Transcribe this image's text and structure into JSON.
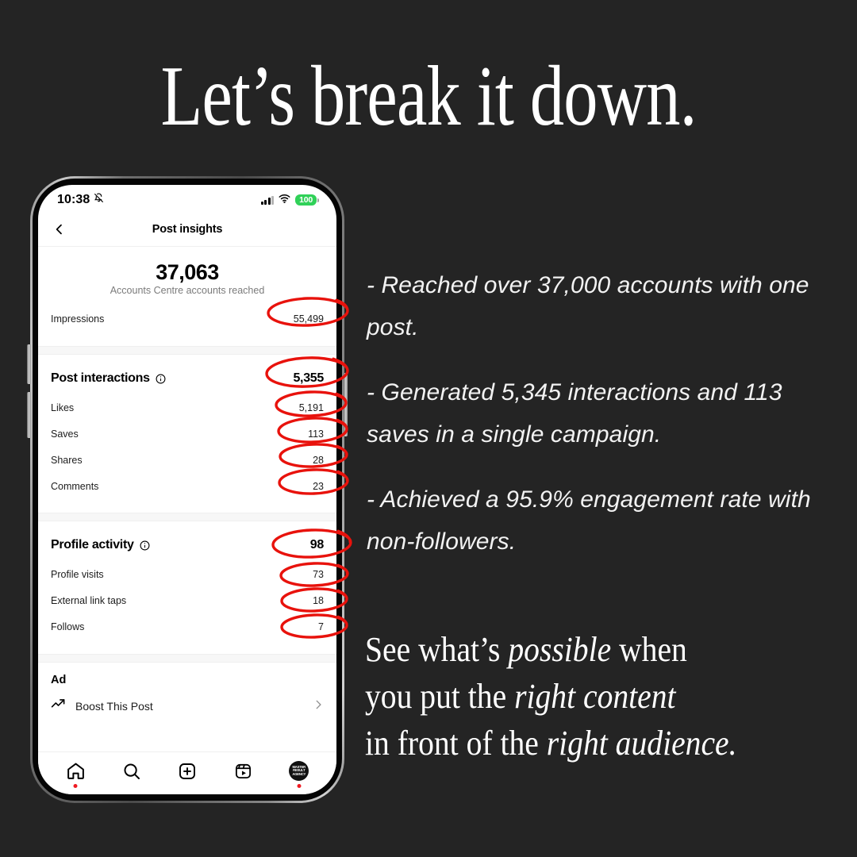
{
  "theme": {
    "background": "#242424",
    "text_primary": "#ffffff",
    "annotation_red": "#ef1b23",
    "battery_green": "#30d158"
  },
  "headline": "Let’s break it down.",
  "phone": {
    "status_bar": {
      "time": "10:38",
      "mute_icon": "bell-slash-icon",
      "signal_icon": "cellular-signal-icon",
      "wifi_icon": "wifi-icon",
      "battery_level": "100"
    },
    "nav": {
      "back_icon": "chevron-left-icon",
      "title": "Post insights"
    },
    "reach": {
      "value": "37,063",
      "label": "Accounts Centre accounts reached"
    },
    "impressions": {
      "label": "Impressions",
      "value": "55,499"
    },
    "post_interactions": {
      "title": "Post interactions",
      "info_icon": "info-circle-icon",
      "total": "5,355",
      "rows": [
        {
          "label": "Likes",
          "value": "5,191"
        },
        {
          "label": "Saves",
          "value": "113"
        },
        {
          "label": "Shares",
          "value": "28"
        },
        {
          "label": "Comments",
          "value": "23"
        }
      ]
    },
    "profile_activity": {
      "title": "Profile activity",
      "info_icon": "info-circle-icon",
      "total": "98",
      "rows": [
        {
          "label": "Profile visits",
          "value": "73"
        },
        {
          "label": "External link taps",
          "value": "18"
        },
        {
          "label": "Follows",
          "value": "7"
        }
      ]
    },
    "ad": {
      "title": "Ad",
      "boost_icon": "trending-up-arrow-icon",
      "boost_label": "Boost This Post",
      "chevron_icon": "chevron-right-icon"
    },
    "tabbar": [
      {
        "name": "home",
        "icon": "home-icon",
        "badge": true
      },
      {
        "name": "search",
        "icon": "search-icon",
        "badge": false
      },
      {
        "name": "create",
        "icon": "plus-square-icon",
        "badge": false
      },
      {
        "name": "reels",
        "icon": "reels-icon",
        "badge": false
      },
      {
        "name": "profile",
        "icon": "avatar-icon",
        "badge": true,
        "avatar_text": "MASTER RESULT AGENCY"
      }
    ]
  },
  "bullets": [
    "- Reached over 37,000 accounts with one post.",
    "- Generated 5,345 interactions and 113 saves in a single campaign.",
    "- Achieved a 95.9% engagement rate with non-followers."
  ],
  "closing": {
    "line1_a": "See what’s ",
    "line1_em": "possible",
    "line1_b": " when",
    "line2_a": "you put the ",
    "line2_em": "right content",
    "line3_a": "in front of the ",
    "line3_em": "right audience."
  }
}
